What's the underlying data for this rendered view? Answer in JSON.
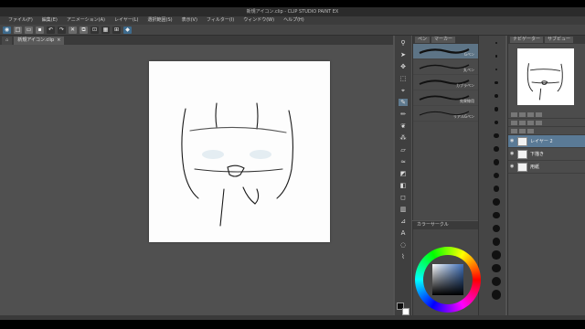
{
  "window": {
    "title": "新規アイコン.clip - CLIP STUDIO PAINT EX"
  },
  "menu": {
    "items": [
      "ファイル(F)",
      "編集(E)",
      "アニメーション(A)",
      "レイヤー(L)",
      "選択範囲(S)",
      "表示(V)",
      "フィルター(I)",
      "ウィンドウ(W)",
      "ヘルプ(H)"
    ]
  },
  "document": {
    "tab_label": "新規アイコン.clip"
  },
  "subtool": {
    "tabs": [
      "ペン",
      "マーカー"
    ],
    "brushes": [
      {
        "name": "Gペン"
      },
      {
        "name": "丸ペン"
      },
      {
        "name": "カブラペン"
      },
      {
        "name": "効果線用"
      },
      {
        "name": "リアルGペン"
      }
    ]
  },
  "sizes": [
    "0.7",
    "1",
    "1.5",
    "2",
    "2.5",
    "3",
    "4",
    "5",
    "6",
    "7",
    "8",
    "10",
    "12",
    "15",
    "17",
    "20",
    "25",
    "30",
    "40",
    "50"
  ],
  "colorpanel": {
    "title": "カラーサークル"
  },
  "navigator": {
    "tabs": [
      "ナビゲーター",
      "サブビュー"
    ]
  },
  "layers": [
    {
      "name": "レイヤー 2"
    },
    {
      "name": "下描き"
    },
    {
      "name": "用紙"
    }
  ],
  "colors": {
    "main": "#0d0d0d",
    "sub": "#ffffff",
    "accent": "#5a7a96"
  }
}
